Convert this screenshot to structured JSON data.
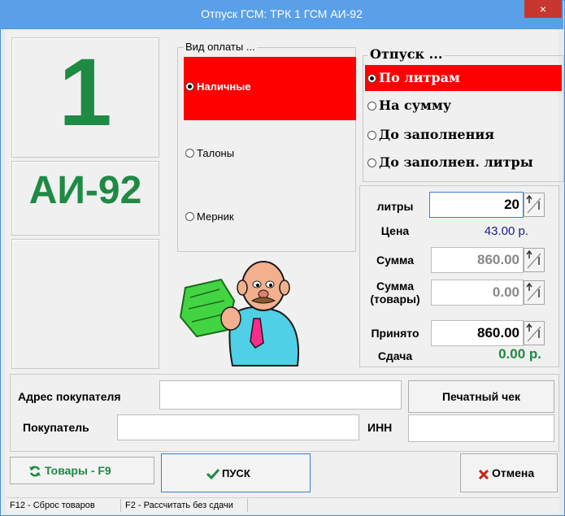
{
  "window": {
    "title": "Отпуск ГСМ:  ТРК 1  ГСМ АИ-92",
    "close_label": "×"
  },
  "pump": {
    "number": "1",
    "fuel": "АИ-92"
  },
  "payment": {
    "legend": "Вид оплаты ...",
    "options": [
      {
        "label": "Наличные",
        "selected": true
      },
      {
        "label": "Талоны",
        "selected": false
      },
      {
        "label": "Мерник",
        "selected": false
      }
    ]
  },
  "dispense": {
    "legend": "Отпуск ...",
    "options": [
      {
        "label": "По литрам",
        "selected": true
      },
      {
        "label": "На сумму",
        "selected": false
      },
      {
        "label": "До заполнения",
        "selected": false
      },
      {
        "label": "До заполнен. литры",
        "selected": false
      }
    ]
  },
  "values": {
    "liters_label": "литры",
    "liters_value": "20",
    "price_label": "Цена",
    "price_value": "43.00 р.",
    "sum_label": "Сумма",
    "sum_value": "860.00",
    "goods_label_1": "Сумма",
    "goods_label_2": "(товары)",
    "goods_value": "0.00",
    "accepted_label": "Принято",
    "accepted_value": "860.00",
    "change_label": "Сдача",
    "change_value": "0.00 р."
  },
  "customer": {
    "address_label": "Адрес покупателя",
    "address_value": "",
    "buyer_label": "Покупатель",
    "buyer_value": "",
    "inn_label": "ИНН",
    "inn_value": "",
    "print_receipt_label": "Печатный чек"
  },
  "actions": {
    "goods_label": "Товары - F9",
    "start_label": "ПУСК",
    "cancel_label": "Отмена"
  },
  "statusbar": {
    "item1": "F12 - Сброс товаров",
    "item2": "F2 - Рассчитать без сдачи"
  },
  "colors": {
    "accent_green": "#1e8a44",
    "selected_red": "#ff0000",
    "title_blue": "#5aa0e8",
    "close_red": "#c7372f"
  }
}
